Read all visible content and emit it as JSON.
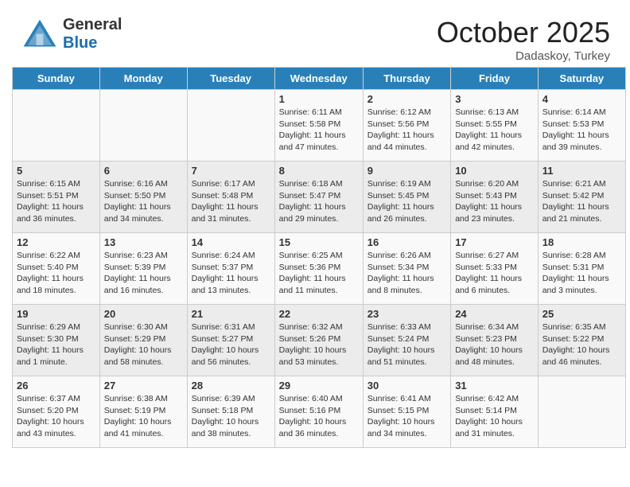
{
  "header": {
    "logo_general": "General",
    "logo_blue": "Blue",
    "month_title": "October 2025",
    "subtitle": "Dadaskoy, Turkey"
  },
  "days_of_week": [
    "Sunday",
    "Monday",
    "Tuesday",
    "Wednesday",
    "Thursday",
    "Friday",
    "Saturday"
  ],
  "weeks": [
    [
      {
        "day": "",
        "sunrise": "",
        "sunset": "",
        "daylight": ""
      },
      {
        "day": "",
        "sunrise": "",
        "sunset": "",
        "daylight": ""
      },
      {
        "day": "",
        "sunrise": "",
        "sunset": "",
        "daylight": ""
      },
      {
        "day": "1",
        "sunrise": "Sunrise: 6:11 AM",
        "sunset": "Sunset: 5:58 PM",
        "daylight": "Daylight: 11 hours and 47 minutes."
      },
      {
        "day": "2",
        "sunrise": "Sunrise: 6:12 AM",
        "sunset": "Sunset: 5:56 PM",
        "daylight": "Daylight: 11 hours and 44 minutes."
      },
      {
        "day": "3",
        "sunrise": "Sunrise: 6:13 AM",
        "sunset": "Sunset: 5:55 PM",
        "daylight": "Daylight: 11 hours and 42 minutes."
      },
      {
        "day": "4",
        "sunrise": "Sunrise: 6:14 AM",
        "sunset": "Sunset: 5:53 PM",
        "daylight": "Daylight: 11 hours and 39 minutes."
      }
    ],
    [
      {
        "day": "5",
        "sunrise": "Sunrise: 6:15 AM",
        "sunset": "Sunset: 5:51 PM",
        "daylight": "Daylight: 11 hours and 36 minutes."
      },
      {
        "day": "6",
        "sunrise": "Sunrise: 6:16 AM",
        "sunset": "Sunset: 5:50 PM",
        "daylight": "Daylight: 11 hours and 34 minutes."
      },
      {
        "day": "7",
        "sunrise": "Sunrise: 6:17 AM",
        "sunset": "Sunset: 5:48 PM",
        "daylight": "Daylight: 11 hours and 31 minutes."
      },
      {
        "day": "8",
        "sunrise": "Sunrise: 6:18 AM",
        "sunset": "Sunset: 5:47 PM",
        "daylight": "Daylight: 11 hours and 29 minutes."
      },
      {
        "day": "9",
        "sunrise": "Sunrise: 6:19 AM",
        "sunset": "Sunset: 5:45 PM",
        "daylight": "Daylight: 11 hours and 26 minutes."
      },
      {
        "day": "10",
        "sunrise": "Sunrise: 6:20 AM",
        "sunset": "Sunset: 5:43 PM",
        "daylight": "Daylight: 11 hours and 23 minutes."
      },
      {
        "day": "11",
        "sunrise": "Sunrise: 6:21 AM",
        "sunset": "Sunset: 5:42 PM",
        "daylight": "Daylight: 11 hours and 21 minutes."
      }
    ],
    [
      {
        "day": "12",
        "sunrise": "Sunrise: 6:22 AM",
        "sunset": "Sunset: 5:40 PM",
        "daylight": "Daylight: 11 hours and 18 minutes."
      },
      {
        "day": "13",
        "sunrise": "Sunrise: 6:23 AM",
        "sunset": "Sunset: 5:39 PM",
        "daylight": "Daylight: 11 hours and 16 minutes."
      },
      {
        "day": "14",
        "sunrise": "Sunrise: 6:24 AM",
        "sunset": "Sunset: 5:37 PM",
        "daylight": "Daylight: 11 hours and 13 minutes."
      },
      {
        "day": "15",
        "sunrise": "Sunrise: 6:25 AM",
        "sunset": "Sunset: 5:36 PM",
        "daylight": "Daylight: 11 hours and 11 minutes."
      },
      {
        "day": "16",
        "sunrise": "Sunrise: 6:26 AM",
        "sunset": "Sunset: 5:34 PM",
        "daylight": "Daylight: 11 hours and 8 minutes."
      },
      {
        "day": "17",
        "sunrise": "Sunrise: 6:27 AM",
        "sunset": "Sunset: 5:33 PM",
        "daylight": "Daylight: 11 hours and 6 minutes."
      },
      {
        "day": "18",
        "sunrise": "Sunrise: 6:28 AM",
        "sunset": "Sunset: 5:31 PM",
        "daylight": "Daylight: 11 hours and 3 minutes."
      }
    ],
    [
      {
        "day": "19",
        "sunrise": "Sunrise: 6:29 AM",
        "sunset": "Sunset: 5:30 PM",
        "daylight": "Daylight: 11 hours and 1 minute."
      },
      {
        "day": "20",
        "sunrise": "Sunrise: 6:30 AM",
        "sunset": "Sunset: 5:29 PM",
        "daylight": "Daylight: 10 hours and 58 minutes."
      },
      {
        "day": "21",
        "sunrise": "Sunrise: 6:31 AM",
        "sunset": "Sunset: 5:27 PM",
        "daylight": "Daylight: 10 hours and 56 minutes."
      },
      {
        "day": "22",
        "sunrise": "Sunrise: 6:32 AM",
        "sunset": "Sunset: 5:26 PM",
        "daylight": "Daylight: 10 hours and 53 minutes."
      },
      {
        "day": "23",
        "sunrise": "Sunrise: 6:33 AM",
        "sunset": "Sunset: 5:24 PM",
        "daylight": "Daylight: 10 hours and 51 minutes."
      },
      {
        "day": "24",
        "sunrise": "Sunrise: 6:34 AM",
        "sunset": "Sunset: 5:23 PM",
        "daylight": "Daylight: 10 hours and 48 minutes."
      },
      {
        "day": "25",
        "sunrise": "Sunrise: 6:35 AM",
        "sunset": "Sunset: 5:22 PM",
        "daylight": "Daylight: 10 hours and 46 minutes."
      }
    ],
    [
      {
        "day": "26",
        "sunrise": "Sunrise: 6:37 AM",
        "sunset": "Sunset: 5:20 PM",
        "daylight": "Daylight: 10 hours and 43 minutes."
      },
      {
        "day": "27",
        "sunrise": "Sunrise: 6:38 AM",
        "sunset": "Sunset: 5:19 PM",
        "daylight": "Daylight: 10 hours and 41 minutes."
      },
      {
        "day": "28",
        "sunrise": "Sunrise: 6:39 AM",
        "sunset": "Sunset: 5:18 PM",
        "daylight": "Daylight: 10 hours and 38 minutes."
      },
      {
        "day": "29",
        "sunrise": "Sunrise: 6:40 AM",
        "sunset": "Sunset: 5:16 PM",
        "daylight": "Daylight: 10 hours and 36 minutes."
      },
      {
        "day": "30",
        "sunrise": "Sunrise: 6:41 AM",
        "sunset": "Sunset: 5:15 PM",
        "daylight": "Daylight: 10 hours and 34 minutes."
      },
      {
        "day": "31",
        "sunrise": "Sunrise: 6:42 AM",
        "sunset": "Sunset: 5:14 PM",
        "daylight": "Daylight: 10 hours and 31 minutes."
      },
      {
        "day": "",
        "sunrise": "",
        "sunset": "",
        "daylight": ""
      }
    ]
  ]
}
